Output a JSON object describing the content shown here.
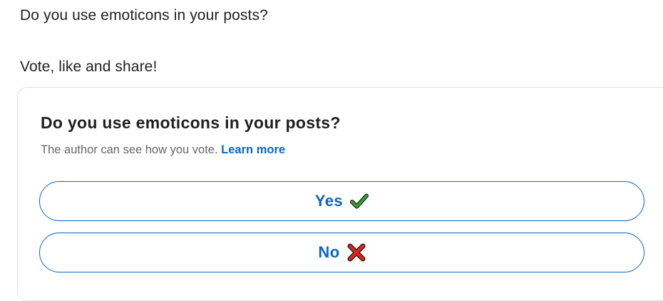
{
  "post": {
    "line1": "Do you use emoticons in your posts?",
    "line2": "Vote, like and share!"
  },
  "poll": {
    "question": "Do you use emoticons in your posts?",
    "note": "The author can see how you vote.",
    "learn_more": "Learn more",
    "options": [
      {
        "label": "Yes",
        "icon": "check-mark-icon",
        "icon_color": "#2fa52b"
      },
      {
        "label": "No",
        "icon": "cross-mark-icon",
        "icon_color": "#e0241b"
      }
    ]
  },
  "colors": {
    "accent": "#0a66c2",
    "text": "#1f1f1f",
    "muted": "#666666",
    "border": "#e2e2e2"
  }
}
